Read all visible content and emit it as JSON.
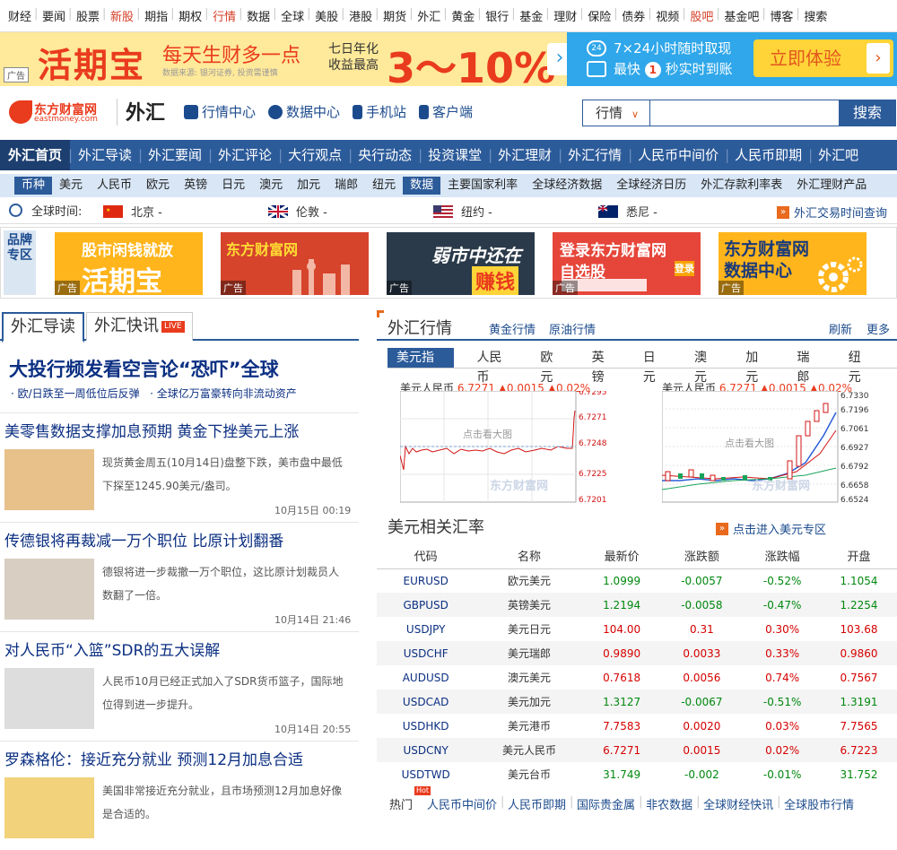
{
  "topnav": [
    {
      "label": "财经",
      "red": false
    },
    {
      "label": "要闻",
      "red": false
    },
    {
      "label": "股票",
      "red": false
    },
    {
      "label": "新股",
      "red": true
    },
    {
      "label": "期指",
      "red": false
    },
    {
      "label": "期权",
      "red": false
    },
    {
      "label": "行情",
      "red": true
    },
    {
      "label": "数据",
      "red": false
    },
    {
      "label": "全球",
      "red": false
    },
    {
      "label": "美股",
      "red": false
    },
    {
      "label": "港股",
      "red": false
    },
    {
      "label": "期货",
      "red": false
    },
    {
      "label": "外汇",
      "red": false
    },
    {
      "label": "黄金",
      "red": false
    },
    {
      "label": "银行",
      "red": false
    },
    {
      "label": "基金",
      "red": false
    },
    {
      "label": "理财",
      "red": false
    },
    {
      "label": "保险",
      "red": false
    },
    {
      "label": "债券",
      "red": false
    },
    {
      "label": "视频",
      "red": false
    },
    {
      "label": "股吧",
      "red": true
    },
    {
      "label": "基金吧",
      "red": false
    },
    {
      "label": "博客",
      "red": false
    },
    {
      "label": "搜索",
      "red": false
    }
  ],
  "ad": {
    "tag": "广告",
    "big": "活期宝",
    "slogan": "每天生财多一点",
    "source": "数据来源: 银河证券, 投资需谨慎",
    "rate_label1": "七日年化",
    "rate_label2": "收益最高",
    "rate": "3～10%",
    "hours_icon": "24",
    "line1": "7×24小时随时取现",
    "line2_a": "最快",
    "line2_num": "1",
    "line2_b": "秒实时到账",
    "cta": "立即体验"
  },
  "header": {
    "logo_cn": "东方财富网",
    "logo_en": "eastmoney.com",
    "title": "外汇",
    "links": [
      {
        "label": "行情中心",
        "icon": "chart-icon"
      },
      {
        "label": "数据中心",
        "icon": "pie-icon"
      },
      {
        "label": "手机站",
        "icon": "phone-icon"
      },
      {
        "label": "客户端",
        "icon": "client-icon"
      }
    ],
    "search_select": "行情",
    "search_button": "搜索"
  },
  "mainnav": [
    "外汇首页",
    "外汇导读",
    "外汇要闻",
    "外汇评论",
    "大行观点",
    "央行动态",
    "投资课堂",
    "外汇理财",
    "外汇行情",
    "人民币中间价",
    "人民币即期",
    "外汇吧"
  ],
  "subnav": [
    {
      "label": "币种",
      "act": true
    },
    {
      "label": "美元",
      "act": false
    },
    {
      "label": "人民币",
      "act": false
    },
    {
      "label": "欧元",
      "act": false
    },
    {
      "label": "英镑",
      "act": false
    },
    {
      "label": "日元",
      "act": false
    },
    {
      "label": "澳元",
      "act": false
    },
    {
      "label": "加元",
      "act": false
    },
    {
      "label": "瑞郎",
      "act": false
    },
    {
      "label": "纽元",
      "act": false
    },
    {
      "label": "数据",
      "act": true
    },
    {
      "label": "主要国家利率",
      "act": false
    },
    {
      "label": "全球经济数据",
      "act": false
    },
    {
      "label": "全球经济日历",
      "act": false
    },
    {
      "label": "外汇存款利率表",
      "act": false
    },
    {
      "label": "外汇理财产品",
      "act": false
    }
  ],
  "timebar": {
    "label": "全球时间:",
    "cities": [
      {
        "name": "北京 -"
      },
      {
        "name": "伦敦 -"
      },
      {
        "name": "纽约 -"
      },
      {
        "name": "悉尼 -"
      }
    ],
    "link": "外汇交易时间查询"
  },
  "brand": {
    "label": "品牌专区",
    "banners": [
      {
        "text": "股市闲钱就放",
        "text2": "活期宝",
        "tag": "广告"
      },
      {
        "text": "东方财富网",
        "text2": "",
        "tag": "广告"
      },
      {
        "text": "弱市中还在",
        "text2": "赚钱",
        "tag": "广告"
      },
      {
        "text": "登录东方财富网",
        "text2": "自选股",
        "tag": "广告",
        "text3": "登录"
      },
      {
        "text": "东方财富网",
        "text2": "数据中心",
        "tag": "广告"
      }
    ]
  },
  "left": {
    "tab1": "外汇导读",
    "tab2": "外汇快讯",
    "live": "LIVE",
    "headline": "大投行频发看空言论“恐吓”全球",
    "sub1": "· 欧/日跌至一周低位后反弹",
    "sub2": "· 全球亿万富豪转向非流动资产",
    "news": [
      {
        "title": "美零售数据支撑加息预期 黄金下挫美元上涨",
        "summary": "现货黄金周五(10月14日)盘整下跌，美市盘中最低下探至1245.90美元/盎司。",
        "time": "10月15日  00:19"
      },
      {
        "title": "传德银将再裁减一万个职位 比原计划翻番",
        "summary": "德银将进一步裁撤一万个职位，这比原计划裁员人数翻了一倍。",
        "time": "10月14日  21:46"
      },
      {
        "title": "对人民币“入篮”SDR的五大误解",
        "summary": "人民币10月已经正式加入了SDR货币篮子，国际地位得到进一步提升。",
        "time": "10月14日  20:55"
      },
      {
        "title": "罗森格伦：接近充分就业 预测12月加息合适",
        "summary": "美国非常接近充分就业，且市场预测12月加息好像是合适的。",
        "time": ""
      }
    ]
  },
  "right": {
    "title": "外汇行情",
    "link1": "黄金行情",
    "link2": "原油行情",
    "refresh": "刷新",
    "more": "更多",
    "tabs": [
      {
        "label": "美元指数",
        "act": true
      },
      {
        "label": "人民币",
        "act": false
      },
      {
        "label": "欧元",
        "act": false
      },
      {
        "label": "英镑",
        "act": false
      },
      {
        "label": "日元",
        "act": false
      },
      {
        "label": "澳元",
        "act": false
      },
      {
        "label": "加元",
        "act": false
      },
      {
        "label": "瑞郎",
        "act": false
      },
      {
        "label": "纽元",
        "act": false
      }
    ],
    "chart1": {
      "name": "美元人民币",
      "price": "6.7271",
      "change": "▲0.0015",
      "pct": "▲0.02%",
      "hint": "点击看大图",
      "ticks": [
        "6.7295",
        "6.7271",
        "6.7248",
        "6.7225",
        "6.7201"
      ]
    },
    "chart2": {
      "name": "美元人民币",
      "price": "6.7271",
      "change": "▲0.0015",
      "pct": "▲0.02%",
      "hint": "点击看大图",
      "ticks": [
        "6.7330",
        "6.7196",
        "6.7061",
        "6.6927",
        "6.6792",
        "6.6658",
        "6.6524"
      ]
    },
    "watermark": "东方财富网",
    "watermark_en": "eastmoney.com",
    "usd_title": "美元相关汇率",
    "usd_link": "点击进入美元专区",
    "table": {
      "headers": [
        "代码",
        "名称",
        "最新价",
        "涨跌额",
        "涨跌幅",
        "开盘"
      ],
      "rows": [
        [
          "EURUSD",
          "欧元美元",
          "1.0999",
          "-0.0057",
          "-0.52%",
          "1.1054"
        ],
        [
          "GBPUSD",
          "英镑美元",
          "1.2194",
          "-0.0058",
          "-0.47%",
          "1.2254"
        ],
        [
          "USDJPY",
          "美元日元",
          "104.00",
          "0.31",
          "0.30%",
          "103.68"
        ],
        [
          "USDCHF",
          "美元瑞郎",
          "0.9890",
          "0.0033",
          "0.33%",
          "0.9860"
        ],
        [
          "AUDUSD",
          "澳元美元",
          "0.7618",
          "0.0056",
          "0.74%",
          "0.7567"
        ],
        [
          "USDCAD",
          "美元加元",
          "1.3127",
          "-0.0067",
          "-0.51%",
          "1.3191"
        ],
        [
          "USDHKD",
          "美元港币",
          "7.7583",
          "0.0020",
          "0.03%",
          "7.7565"
        ],
        [
          "USDCNY",
          "美元人民币",
          "6.7271",
          "0.0015",
          "0.02%",
          "6.7223"
        ],
        [
          "USDTWD",
          "美元台币",
          "31.749",
          "-0.002",
          "-0.01%",
          "31.752"
        ]
      ]
    },
    "hot_label": "热门",
    "hot_badge": "Hot",
    "hot_links": [
      "人民币中间价",
      "人民币即期",
      "国际贵金属",
      "非农数据",
      "全球财经快讯",
      "全球股市行情"
    ]
  }
}
